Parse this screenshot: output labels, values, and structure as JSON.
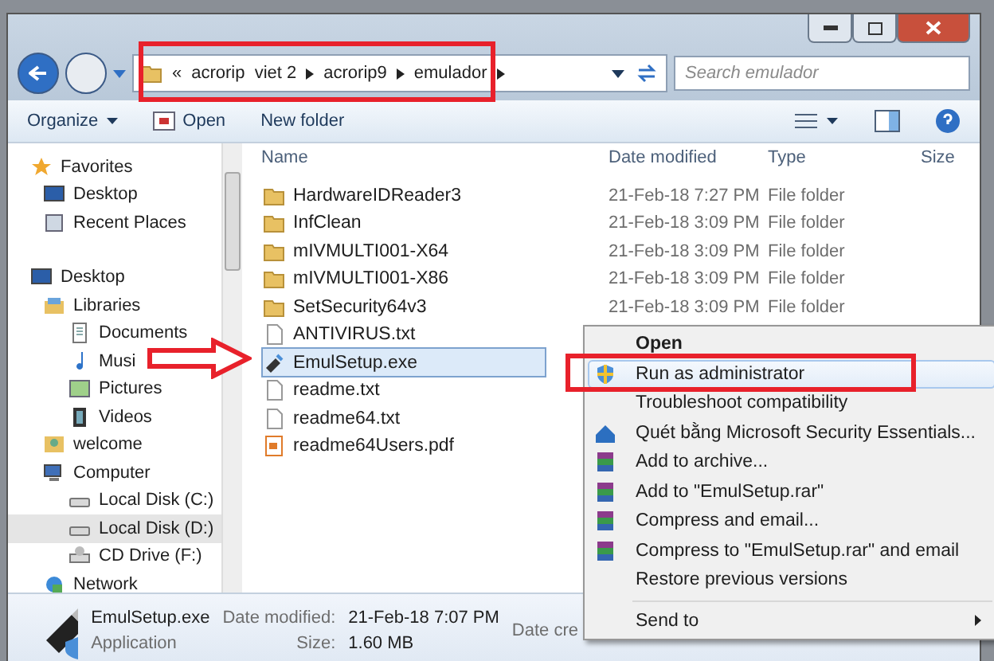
{
  "window": {
    "address": {
      "overflow": "«",
      "crumbs": [
        "acrorip  viet 2",
        "acrorip9",
        "emulador"
      ]
    },
    "search": {
      "placeholder": "Search emulador"
    }
  },
  "toolbar": {
    "organize": "Organize",
    "open": "Open",
    "new_folder": "New folder"
  },
  "nav": [
    {
      "label": "Favorites",
      "kind": "star",
      "selected": false,
      "children": [
        {
          "label": "Desktop",
          "kind": "desktop",
          "selected": false
        },
        {
          "label": "Recent Places",
          "kind": "recent",
          "selected": false
        }
      ]
    },
    {
      "label": "Desktop",
      "kind": "desktop",
      "selected": false,
      "children": [
        {
          "label": "Libraries",
          "kind": "library",
          "selected": false,
          "children": [
            {
              "label": "Documents",
              "kind": "doc",
              "selected": false
            },
            {
              "label": "Musi",
              "kind": "music",
              "selected": false
            },
            {
              "label": "Pictures",
              "kind": "picture",
              "selected": false
            },
            {
              "label": "Videos",
              "kind": "video",
              "selected": false
            }
          ]
        },
        {
          "label": "welcome",
          "kind": "user",
          "selected": false
        },
        {
          "label": "Computer",
          "kind": "computer",
          "selected": false,
          "children": [
            {
              "label": "Local Disk (C:)",
              "kind": "disk",
              "selected": false
            },
            {
              "label": "Local Disk (D:)",
              "kind": "disk",
              "selected": true
            },
            {
              "label": "CD Drive (F:)",
              "kind": "cd",
              "selected": false
            }
          ]
        },
        {
          "label": "Network",
          "kind": "network",
          "selected": false
        }
      ]
    }
  ],
  "table": {
    "columns": [
      "Name",
      "Date modified",
      "Type",
      "Size"
    ],
    "rows": [
      {
        "name": "HardwareIDReader3",
        "date": "21-Feb-18 7:27 PM",
        "type": "File folder",
        "kind": "folder",
        "selected": false
      },
      {
        "name": "InfClean",
        "date": "21-Feb-18 3:09 PM",
        "type": "File folder",
        "kind": "folder",
        "selected": false
      },
      {
        "name": "mIVMULTI001-X64",
        "date": "21-Feb-18 3:09 PM",
        "type": "File folder",
        "kind": "folder",
        "selected": false
      },
      {
        "name": "mIVMULTI001-X86",
        "date": "21-Feb-18 3:09 PM",
        "type": "File folder",
        "kind": "folder",
        "selected": false
      },
      {
        "name": "SetSecurity64v3",
        "date": "21-Feb-18 3:09 PM",
        "type": "File folder",
        "kind": "folder",
        "selected": false
      },
      {
        "name": "ANTIVIRUS.txt",
        "kind": "text",
        "selected": false
      },
      {
        "name": "EmulSetup.exe",
        "kind": "exe",
        "selected": true
      },
      {
        "name": "readme.txt",
        "kind": "text",
        "selected": false
      },
      {
        "name": "readme64.txt",
        "kind": "text",
        "selected": false
      },
      {
        "name": "readme64Users.pdf",
        "kind": "pdf",
        "selected": false
      }
    ]
  },
  "details": {
    "name": "EmulSetup.exe",
    "type": "Application",
    "modified_label": "Date modified:",
    "modified": "21-Feb-18 7:07 PM",
    "size_label": "Size:",
    "size": "1.60 MB",
    "created_label": "Date cre"
  },
  "context_menu": [
    {
      "label": "Open",
      "kind": "default",
      "selected": false
    },
    {
      "label": "Run as administrator",
      "kind": "shield",
      "selected": true
    },
    {
      "label": "Troubleshoot compatibility",
      "kind": "plain",
      "selected": false
    },
    {
      "label": "Quét bằng Microsoft Security Essentials...",
      "kind": "security",
      "selected": false
    },
    {
      "label": "Add to archive...",
      "kind": "archive",
      "selected": false
    },
    {
      "label": "Add to \"EmulSetup.rar\"",
      "kind": "archive",
      "selected": false
    },
    {
      "label": "Compress and email...",
      "kind": "archive",
      "selected": false
    },
    {
      "label": "Compress to \"EmulSetup.rar\" and email",
      "kind": "archive",
      "selected": false
    },
    {
      "label": "Restore previous versions",
      "kind": "plain",
      "selected": false
    },
    {
      "kind": "separator"
    },
    {
      "label": "Send to",
      "kind": "submenu",
      "selected": false
    }
  ]
}
